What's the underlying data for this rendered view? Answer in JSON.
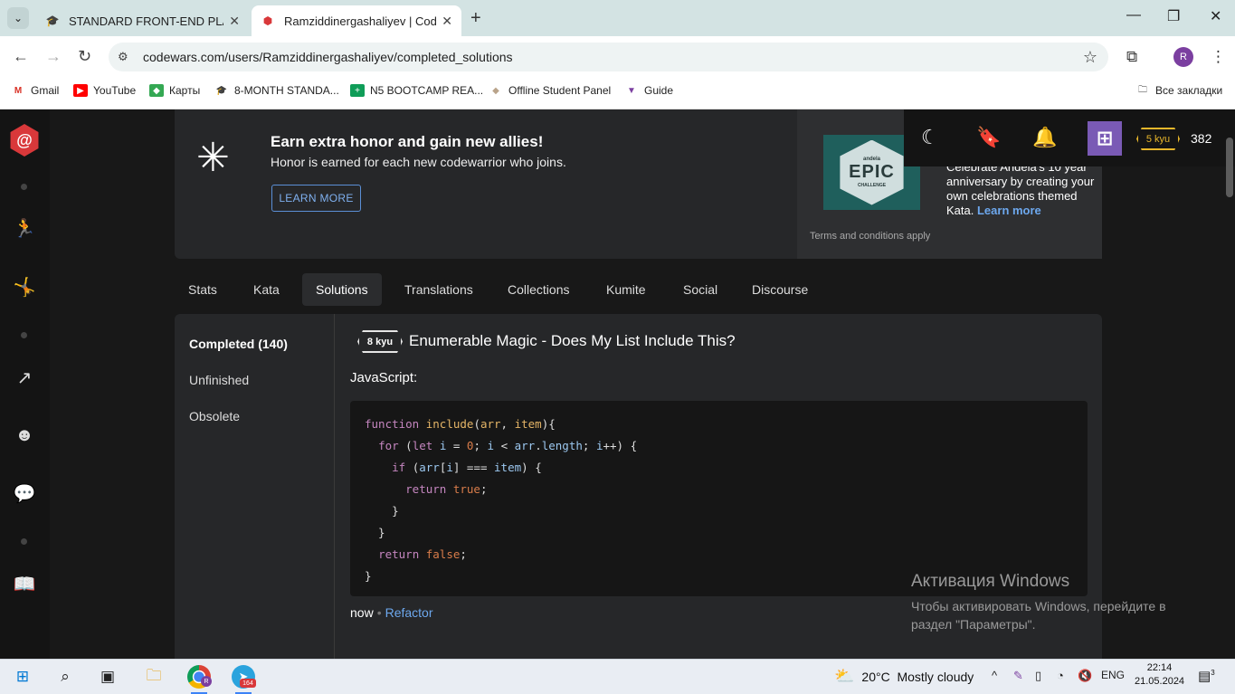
{
  "browser": {
    "tabs": [
      {
        "title": "STANDARD FRONT-END PLAN",
        "icon": "graduation-cap-icon"
      },
      {
        "title": "Ramziddinergashaliyev | Codew",
        "icon": "codewars-icon"
      }
    ],
    "url": "codewars.com/users/Ramziddinergashaliyev/completed_solutions",
    "profile_initial": "R",
    "bookmarks": [
      {
        "label": "Gmail",
        "color": "#d93025"
      },
      {
        "label": "YouTube",
        "color": "#ff0000"
      },
      {
        "label": "Карты",
        "color": "#34a853"
      },
      {
        "label": "8-MONTH STANDA...",
        "color": "#333333"
      },
      {
        "label": "N5 BOOTCAMP REA...",
        "color": "#0f9d58"
      },
      {
        "label": "Offline Student Panel",
        "color": "#b9a38a"
      },
      {
        "label": "Guide",
        "color": "#7b3fa0"
      }
    ],
    "all_bookmarks": "Все закладки"
  },
  "banner": {
    "title": "Earn extra honor and gain new allies!",
    "subtitle": "Honor is earned for each new codewarrior who joins.",
    "button": "LEARN MORE",
    "epic": {
      "badge_top": "andela",
      "badge_main": "EPIC",
      "badge_bottom": "CHALLENGE",
      "text": "Celebrate Andela's 10 year anniversary by creating your own celebrations themed Kata.",
      "link": "Learn more",
      "terms": "Terms and conditions apply"
    }
  },
  "user": {
    "kyu": "5 kyu",
    "honor": "382"
  },
  "profile_tabs": [
    "Stats",
    "Kata",
    "Solutions",
    "Translations",
    "Collections",
    "Kumite",
    "Social",
    "Discourse"
  ],
  "active_tab": "Solutions",
  "solutions_sidebar": [
    "Completed (140)",
    "Unfinished",
    "Obsolete"
  ],
  "solution": {
    "rank": "8 kyu",
    "title": "Enumerable Magic - Does My List Include This?",
    "language": "JavaScript:",
    "time": "now",
    "action": "Refactor"
  },
  "watermark": {
    "title": "Активация Windows",
    "text": "Чтобы активировать Windows, перейдите в раздел \"Параметры\"."
  },
  "taskbar": {
    "telegram_badge": "164",
    "chrome_profile": "R",
    "weather_temp": "20°C",
    "weather_desc": "Mostly cloudy",
    "lang": "ENG",
    "time": "22:14",
    "date": "21.05.2024",
    "notifications": "3"
  }
}
